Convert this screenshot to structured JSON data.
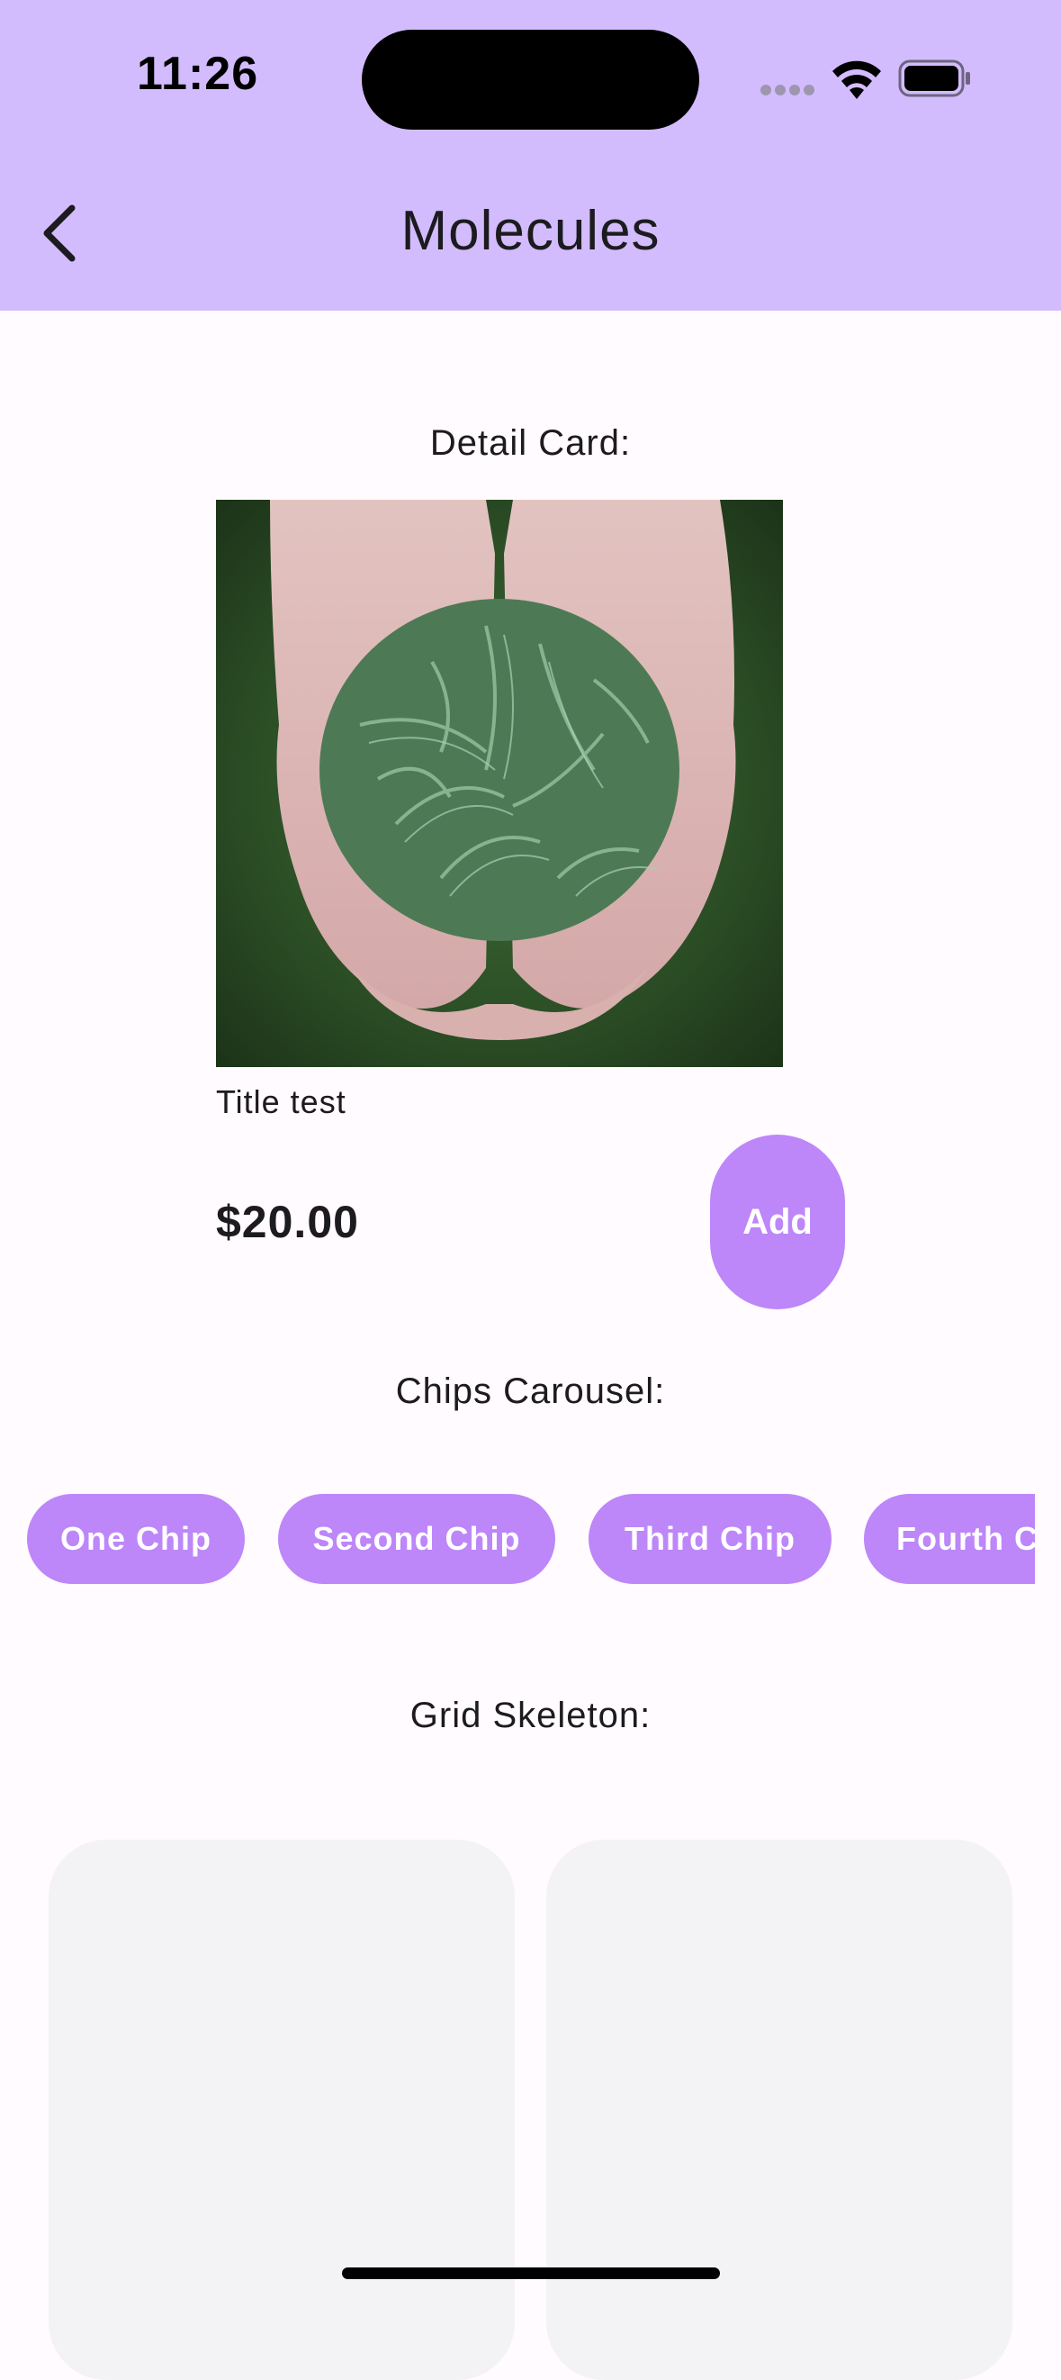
{
  "status_bar": {
    "time": "11:26"
  },
  "header": {
    "title": "Molecules",
    "back_icon": "chevron-left-icon"
  },
  "detail_card": {
    "section_title": "Detail Card:",
    "image": "photo of cupped hands holding green spruce tips",
    "title": "Title test",
    "price": "$20.00",
    "add_label": "Add"
  },
  "chips_carousel": {
    "section_title": "Chips Carousel:",
    "chips": [
      {
        "label": "One Chip"
      },
      {
        "label": "Second Chip"
      },
      {
        "label": "Third Chip"
      },
      {
        "label": "Fourth Chip"
      }
    ]
  },
  "grid_skeleton": {
    "section_title": "Grid Skeleton:"
  },
  "colors": {
    "header_bg": "#D3BCFD",
    "accent": "#BD86F9",
    "page_bg": "#FFFBFE",
    "skeleton": "#F3F2F4",
    "text": "#1C1B1F"
  }
}
